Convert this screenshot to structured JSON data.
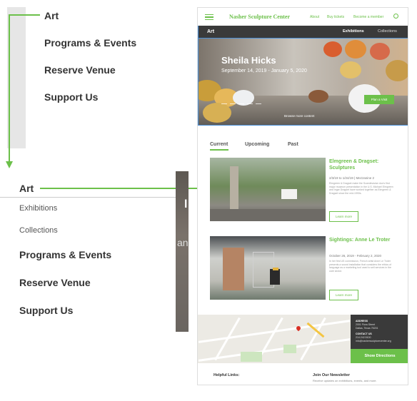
{
  "desktop_menu": {
    "items": [
      "Art",
      "Programs & Events",
      "Reserve Venue",
      "Support Us"
    ]
  },
  "mobile_menu": {
    "items": [
      {
        "label": "Art",
        "level": "main"
      },
      {
        "label": "Exhibitions",
        "level": "sub"
      },
      {
        "label": "Collections",
        "level": "sub"
      },
      {
        "label": "Programs & Events",
        "level": "main"
      },
      {
        "label": "Reserve Venue",
        "level": "main"
      },
      {
        "label": "Support Us",
        "level": "main"
      }
    ]
  },
  "hero_peek": {
    "letter": "l",
    "text": "an"
  },
  "page": {
    "logo": "Nasher Sculpture Center",
    "nav": [
      "About",
      "Buy tickets",
      "Become a member"
    ],
    "section_title": "Art",
    "section_links": [
      "Exhibitions",
      "Collections"
    ],
    "hero": {
      "title": "Sheila Hicks",
      "dates": "September 14, 2019 - January 5, 2020",
      "button": "Plan a Visit",
      "browse": "Browse more content"
    },
    "tabs": [
      "Current",
      "Upcoming",
      "Past"
    ],
    "cards": [
      {
        "title": "Elmgreen & Dragset: Sculptures",
        "date": "2/3/19 to 1/24/19 | Mezzanine 2",
        "desc": "Elmgreen & Dragset make the Scandinavian duo's first major museum presentation in the U.S. Michael Elmgreen and Ingar Dragset have worked together as Elmgreen & Dragset since the mid-1990s.",
        "button": "Learn more"
      },
      {
        "title": "Sightings: Anne Le Troter",
        "date": "October 26, 2019 - February 2, 2020",
        "desc": "In her first US commission, French artist Anne Le Troter presents a sound installation that considers the ethics of language as a marketing tool used to sell services in the care sector.",
        "button": "Learn more"
      }
    ],
    "map_info": {
      "address_label": "ADDRESS",
      "address_lines": [
        "2001 Flora Street",
        "Dallas, Texas 75201"
      ],
      "contact_label": "CONTACT US",
      "contact_lines": [
        "214.242.5100",
        "info@nashersculpturecenter.org"
      ],
      "button": "Show Directions"
    },
    "footer": {
      "helpful": "Helpful Links:",
      "newsletter": "Join Our Newsletter",
      "newsletter_sub": "Receive updates on exhibitions, events, and more."
    }
  },
  "colors": {
    "accent": "#6cc04a",
    "dark": "#3a3a3a"
  }
}
